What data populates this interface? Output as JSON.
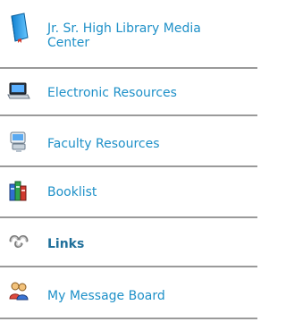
{
  "nav": {
    "items": [
      {
        "label_line1": "Jr. Sr. High Library Media",
        "label_line2": "Center",
        "icon": "book-icon"
      },
      {
        "label": "Electronic Resources",
        "icon": "laptop-icon"
      },
      {
        "label": "Faculty Resources",
        "icon": "computer-icon"
      },
      {
        "label": "Booklist",
        "icon": "books-icon"
      },
      {
        "label": "Links",
        "icon": "chain-link-icon",
        "active": true
      },
      {
        "label": "My Message Board",
        "icon": "people-icon"
      }
    ]
  }
}
